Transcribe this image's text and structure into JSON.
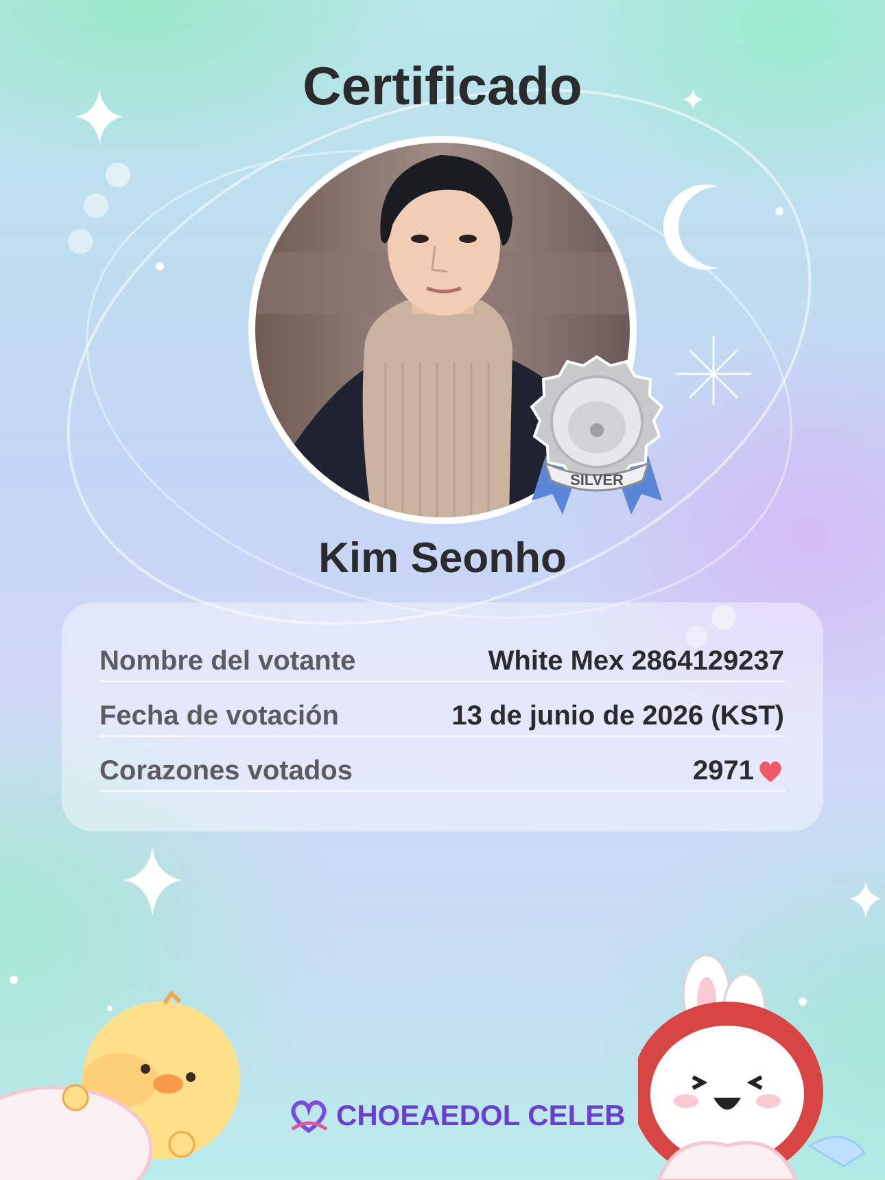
{
  "title": "Certificado",
  "celebrity": {
    "name": "Kim Seonho"
  },
  "badge": {
    "tier": "SILVER"
  },
  "details": [
    {
      "label": "Nombre del votante",
      "value": "White Mex 2864129237"
    },
    {
      "label": "Fecha de votación",
      "value": "13 de junio de 2026 (KST)"
    },
    {
      "label": "Corazones votados",
      "value": "2971"
    }
  ],
  "brand": {
    "name": "CHOEAEDOL CELEB"
  },
  "colors": {
    "brand": "#6a3fd0",
    "heart": "#f05a66",
    "text": "#2b2b2d"
  },
  "icons": [
    "sparkle-icon",
    "moon-icon",
    "heart-icon",
    "silver-medal-icon",
    "brand-heart-logo-icon"
  ]
}
